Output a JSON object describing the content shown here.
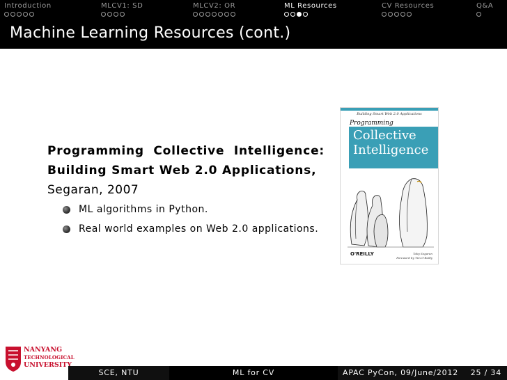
{
  "nav": {
    "sections": [
      {
        "label": "Introduction",
        "dots": 5,
        "filled_index": -1,
        "active": false
      },
      {
        "label": "MLCV1: SD",
        "dots": 4,
        "filled_index": -1,
        "active": false
      },
      {
        "label": "MLCV2: OR",
        "dots": 7,
        "filled_index": -1,
        "active": false
      },
      {
        "label": "ML Resources",
        "dots": 4,
        "filled_index": 2,
        "active": true
      },
      {
        "label": "CV Resources",
        "dots": 5,
        "filled_index": -1,
        "active": false
      },
      {
        "label": "Q&A",
        "dots": 1,
        "filled_index": -1,
        "active": false
      }
    ]
  },
  "slide": {
    "title": "Machine Learning Resources (cont.)",
    "book_title": "Programming Collective Intelligence: Building Smart Web 2.0 Applications",
    "book_title_suffix": ",",
    "book_author": "Segaran, 2007",
    "bullets": [
      "ML algorithms in Python.",
      "Real world examples on Web 2.0 applications."
    ]
  },
  "cover": {
    "subtitle": "Building Smart Web 2.0 Applications",
    "small_title": "Programming",
    "big_title_line1": "Collective",
    "big_title_line2": "Intelligence",
    "author_line1": "Toby Segaran",
    "author_line2": "Foreword by Tim O'Reilly",
    "publisher": "O'REILLY",
    "accent_color": "#3a9fb6"
  },
  "logo": {
    "line1": "NANYANG",
    "line2": "TECHNOLOGICAL",
    "line3": "UNIVERSITY",
    "color": "#c8102e"
  },
  "footer": {
    "left": "SCE, NTU",
    "middle": "ML for CV",
    "event": "APAC PyCon, 09/June/2012",
    "page": "25 / 34"
  }
}
